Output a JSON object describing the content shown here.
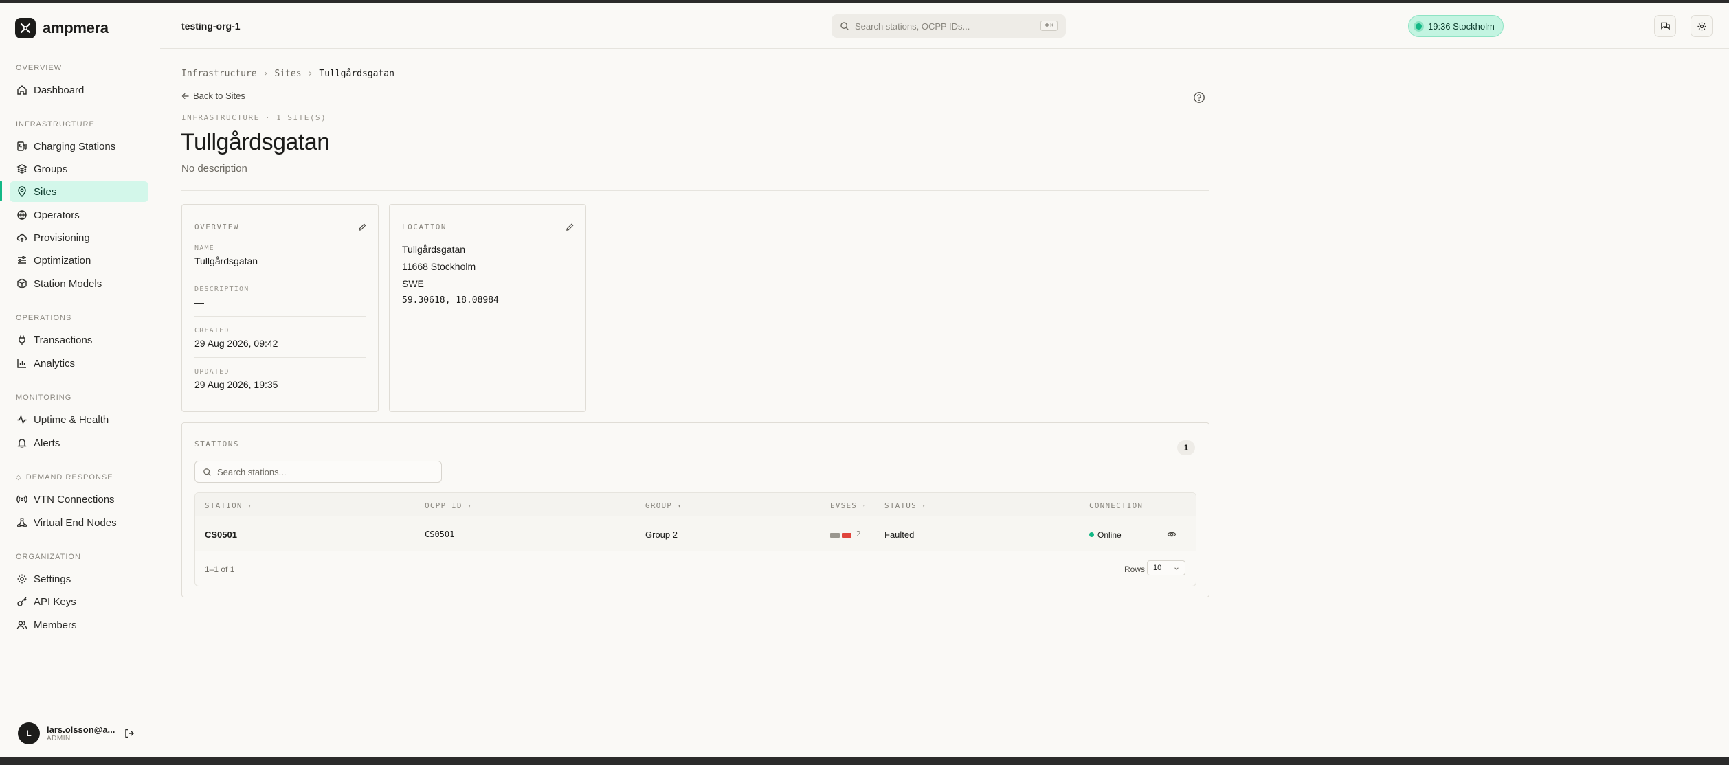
{
  "brand": {
    "name": "ampmera"
  },
  "org": {
    "name": "testing-org-1"
  },
  "search": {
    "placeholder": "Search stations, OCPP IDs...",
    "shortcut": "⌘K"
  },
  "clock": {
    "label": "19:36 Stockholm"
  },
  "sidebar": {
    "sections": {
      "overview": "OVERVIEW",
      "infrastructure": "INFRASTRUCTURE",
      "operations": "OPERATIONS",
      "monitoring": "MONITORING",
      "demand_response": "DEMAND RESPONSE",
      "organization": "ORGANIZATION"
    },
    "items": {
      "dashboard": "Dashboard",
      "charging_stations": "Charging Stations",
      "groups": "Groups",
      "sites": "Sites",
      "operators": "Operators",
      "provisioning": "Provisioning",
      "optimization": "Optimization",
      "station_models": "Station Models",
      "transactions": "Transactions",
      "analytics": "Analytics",
      "uptime_health": "Uptime & Health",
      "alerts": "Alerts",
      "vtn_connections": "VTN Connections",
      "virtual_end_nodes": "Virtual End Nodes",
      "settings": "Settings",
      "api_keys": "API Keys",
      "members": "Members"
    },
    "active": "sites"
  },
  "user": {
    "initial": "L",
    "email": "lars.olsson@a...",
    "role": "ADMIN"
  },
  "breadcrumb": {
    "items": [
      "Infrastructure",
      "Sites",
      "Tullgårdsgatan"
    ],
    "separator": "›"
  },
  "back_link": "Back to Sites",
  "eyebrow": "INFRASTRUCTURE · 1 SITE(S)",
  "page": {
    "title": "Tullgårdsgatan",
    "subtitle": "No description"
  },
  "overview_card": {
    "label": "OVERVIEW",
    "fields": [
      {
        "label": "NAME",
        "value": "Tullgårdsgatan"
      },
      {
        "label": "DESCRIPTION",
        "value": "—"
      },
      {
        "label": "CREATED",
        "value": "29 Aug 2026, 09:42"
      },
      {
        "label": "UPDATED",
        "value": "29 Aug 2026, 19:35"
      }
    ]
  },
  "location_card": {
    "label": "LOCATION",
    "street": "Tullgårdsgatan",
    "postal_city": "11668 Stockholm",
    "country": "SWE",
    "coordinates": "59.30618, 18.08984"
  },
  "stations": {
    "label": "STATIONS",
    "count": "1",
    "search_placeholder": "Search stations...",
    "columns": {
      "station": "STATION",
      "ocpp_id": "OCPP ID",
      "group": "GROUP",
      "evses": "EVSES",
      "status": "STATUS",
      "connection": "CONNECTION"
    },
    "sort_glyph": "⬍",
    "rows": [
      {
        "station": "CS0501",
        "ocpp_id": "CS0501",
        "group": "Group 2",
        "evse_count": "2",
        "status": "Faulted",
        "connection": "Online"
      }
    ],
    "pagination": "1–1 of 1",
    "rows_label": "Rows",
    "rows_value": "10"
  },
  "colors": {
    "accent": "#14b886",
    "active_bg": "#d3f7ea",
    "evse_idle": "#9a978f",
    "evse_faulted": "#e0443c"
  }
}
